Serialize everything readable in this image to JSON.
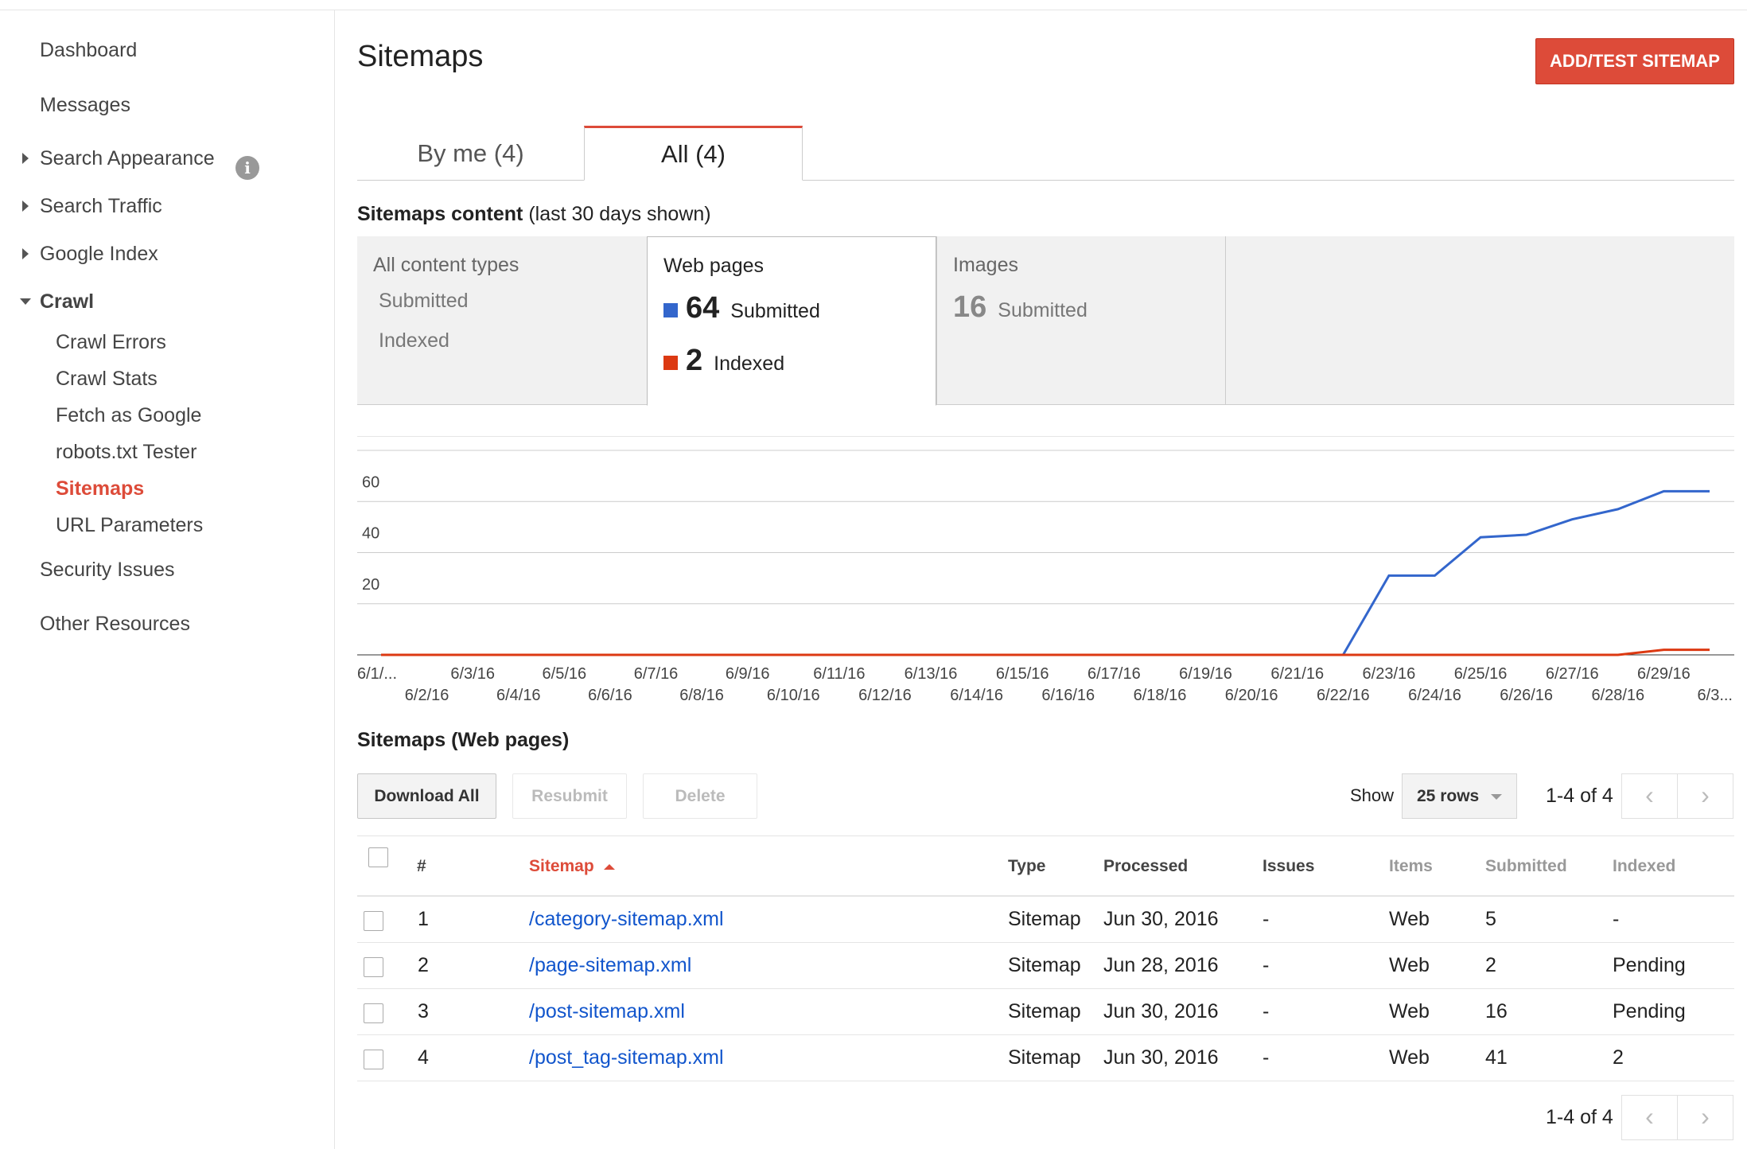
{
  "sidebar": {
    "dashboard": "Dashboard",
    "messages": "Messages",
    "search_appearance": "Search Appearance",
    "search_traffic": "Search Traffic",
    "google_index": "Google Index",
    "crawl": "Crawl",
    "crawl_items": [
      "Crawl Errors",
      "Crawl Stats",
      "Fetch as Google",
      "robots.txt Tester",
      "Sitemaps",
      "URL Parameters"
    ],
    "security_issues": "Security Issues",
    "other_resources": "Other Resources",
    "info_glyph": "i"
  },
  "header": {
    "title": "Sitemaps",
    "add_test_button": "ADD/TEST SITEMAP"
  },
  "tabs": [
    {
      "label": "By me (4)"
    },
    {
      "label": "All (4)"
    }
  ],
  "content_section": {
    "title": "Sitemaps content",
    "note": "(last 30 days shown)"
  },
  "cards": {
    "all_types": {
      "title": "All content types",
      "submitted": "Submitted",
      "indexed": "Indexed"
    },
    "web": {
      "title": "Web pages",
      "submitted_value": "64",
      "submitted_label": "Submitted",
      "indexed_value": "2",
      "indexed_label": "Indexed"
    },
    "images": {
      "title": "Images",
      "submitted_value": "16",
      "submitted_label": "Submitted"
    }
  },
  "colors": {
    "accent": "#dd4b39",
    "submitted": "#3366cc",
    "indexed": "#dc3912",
    "link": "#1155cc"
  },
  "chart_data": {
    "type": "line",
    "x": [
      "6/1/...",
      "6/2/16",
      "6/3/16",
      "6/4/16",
      "6/5/16",
      "6/6/16",
      "6/7/16",
      "6/8/16",
      "6/9/16",
      "6/10/16",
      "6/11/16",
      "6/12/16",
      "6/13/16",
      "6/14/16",
      "6/15/16",
      "6/16/16",
      "6/17/16",
      "6/18/16",
      "6/19/16",
      "6/20/16",
      "6/21/16",
      "6/22/16",
      "6/23/16",
      "6/24/16",
      "6/25/16",
      "6/26/16",
      "6/27/16",
      "6/28/16",
      "6/29/16",
      "6/3..."
    ],
    "series": [
      {
        "name": "Submitted",
        "color": "#3366cc",
        "values": [
          0,
          0,
          0,
          0,
          0,
          0,
          0,
          0,
          0,
          0,
          0,
          0,
          0,
          0,
          0,
          0,
          0,
          0,
          0,
          0,
          0,
          0,
          31,
          31,
          46,
          47,
          53,
          57,
          64,
          64
        ]
      },
      {
        "name": "Indexed",
        "color": "#dc3912",
        "values": [
          0,
          0,
          0,
          0,
          0,
          0,
          0,
          0,
          0,
          0,
          0,
          0,
          0,
          0,
          0,
          0,
          0,
          0,
          0,
          0,
          0,
          0,
          0,
          0,
          0,
          0,
          0,
          0,
          2,
          2
        ]
      }
    ],
    "yticks": [
      "20",
      "40",
      "60",
      "80"
    ],
    "ylim": [
      0,
      80
    ],
    "grid": true
  },
  "table_section": {
    "title": "Sitemaps (Web pages)",
    "download_all": "Download All",
    "resubmit": "Resubmit",
    "delete": "Delete",
    "show_label": "Show",
    "rows_select": "25 rows",
    "pager": "1-4 of 4",
    "prev_glyph": "‹",
    "next_glyph": "›"
  },
  "table": {
    "headers": [
      "#",
      "Sitemap",
      "Type",
      "Processed",
      "Issues",
      "Items",
      "Submitted",
      "Indexed"
    ],
    "rows": [
      {
        "n": "1",
        "sitemap": "/category-sitemap.xml",
        "type": "Sitemap",
        "processed": "Jun 30, 2016",
        "issues": "-",
        "items": "Web",
        "submitted": "5",
        "indexed": "-"
      },
      {
        "n": "2",
        "sitemap": "/page-sitemap.xml",
        "type": "Sitemap",
        "processed": "Jun 28, 2016",
        "issues": "-",
        "items": "Web",
        "submitted": "2",
        "indexed": "Pending"
      },
      {
        "n": "3",
        "sitemap": "/post-sitemap.xml",
        "type": "Sitemap",
        "processed": "Jun 30, 2016",
        "issues": "-",
        "items": "Web",
        "submitted": "16",
        "indexed": "Pending"
      },
      {
        "n": "4",
        "sitemap": "/post_tag-sitemap.xml",
        "type": "Sitemap",
        "processed": "Jun 30, 2016",
        "issues": "-",
        "items": "Web",
        "submitted": "41",
        "indexed": "2"
      }
    ]
  }
}
